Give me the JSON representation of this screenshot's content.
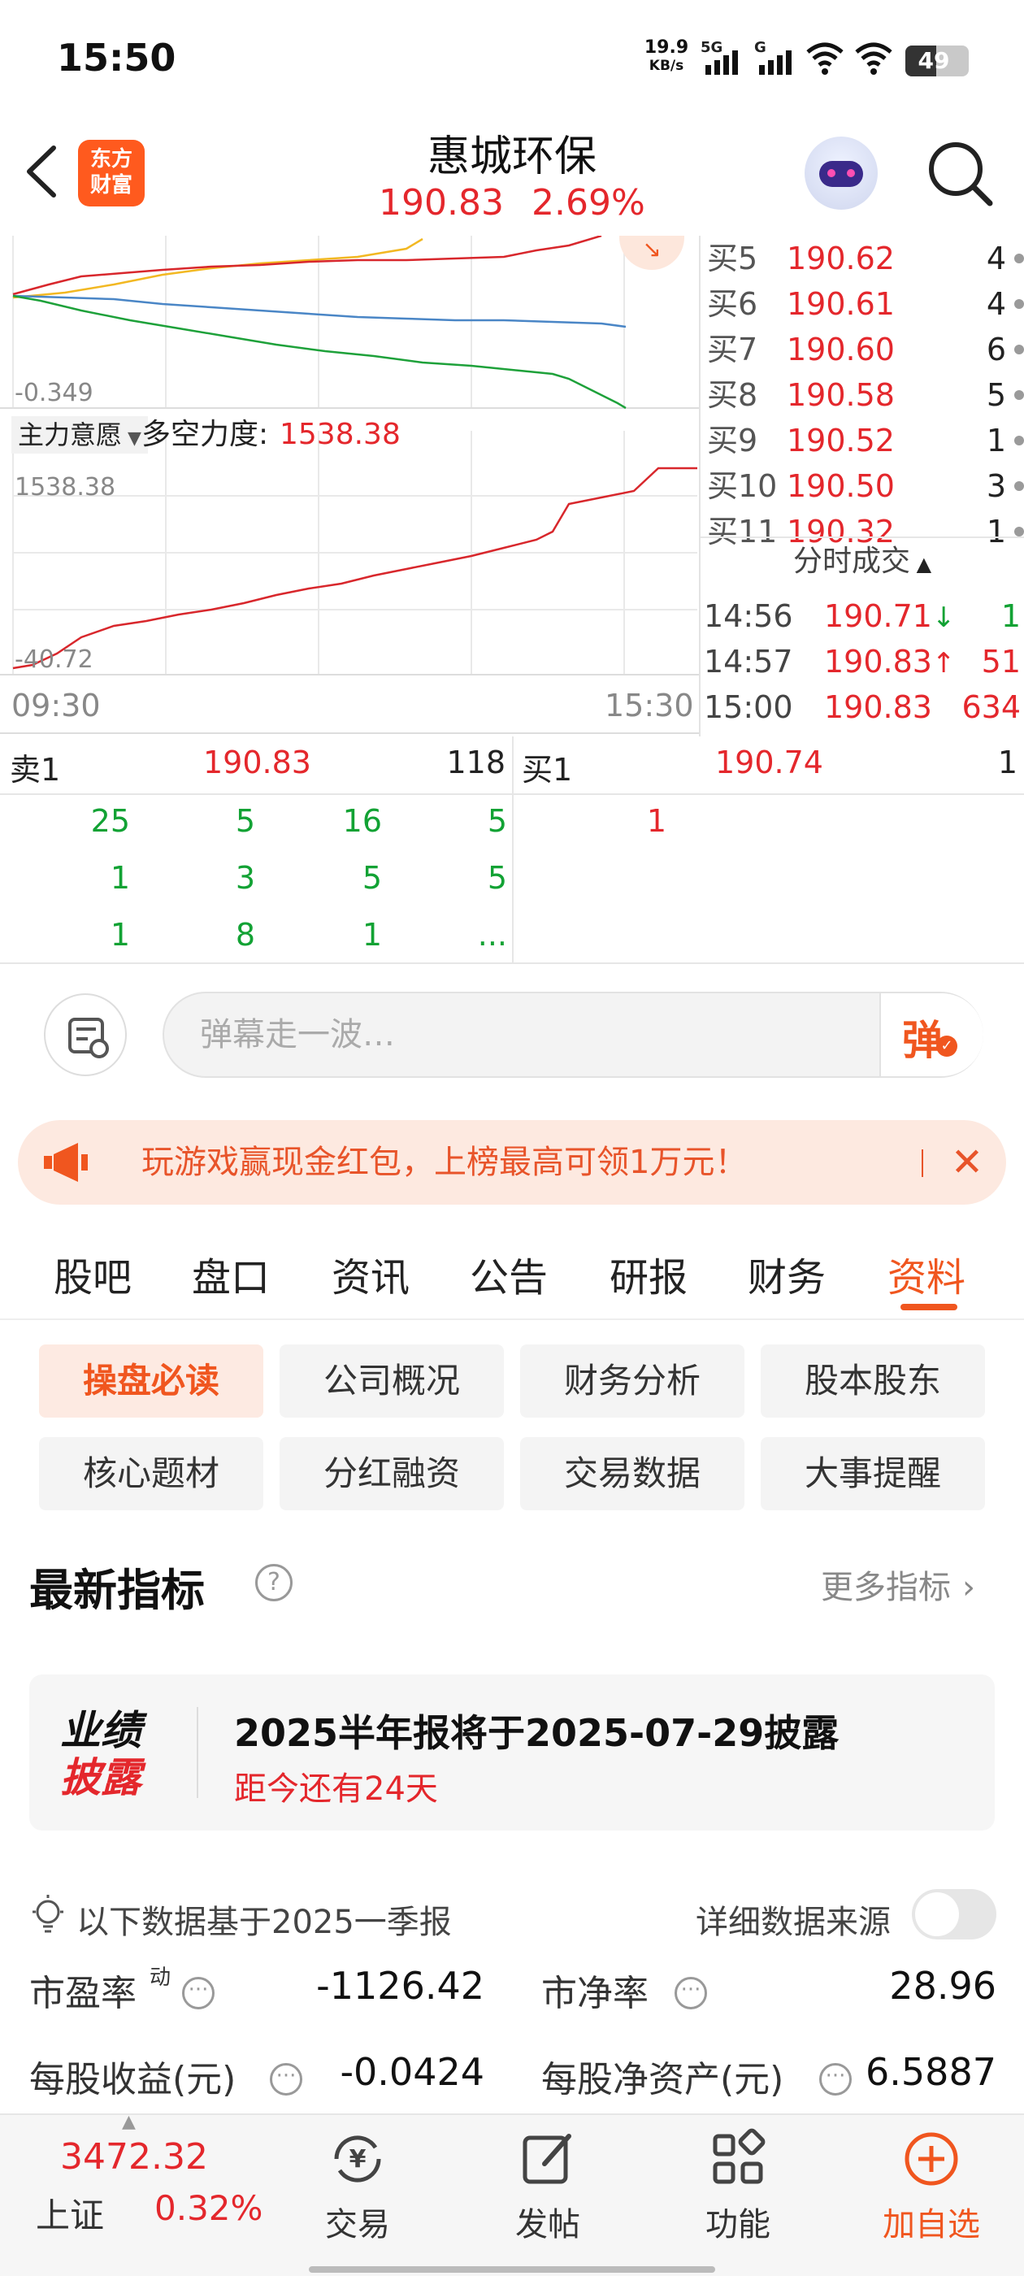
{
  "status_bar": {
    "time": "15:50",
    "net_speed": "19.9",
    "net_unit": "KB/s",
    "signal1": "5G",
    "signal2": "G",
    "battery": "49"
  },
  "header": {
    "logo_line1": "东方",
    "logo_line2": "财富",
    "stock_name": "惠城环保",
    "price": "190.83",
    "change_pct": "2.69%"
  },
  "chart1": {
    "min_label": "-0.349"
  },
  "indicator": {
    "dropdown": "主力意愿",
    "label": "多空力度:",
    "value": "1538.38",
    "max_label": "1538.38",
    "min_label": "-40.72",
    "time_start": "09:30",
    "time_end": "15:30"
  },
  "order_book": [
    {
      "label": "买5",
      "price": "190.62",
      "vol": "4"
    },
    {
      "label": "买6",
      "price": "190.61",
      "vol": "4"
    },
    {
      "label": "买7",
      "price": "190.60",
      "vol": "6"
    },
    {
      "label": "买8",
      "price": "190.58",
      "vol": "5"
    },
    {
      "label": "买9",
      "price": "190.52",
      "vol": "1"
    },
    {
      "label": "买10",
      "price": "190.50",
      "vol": "3"
    },
    {
      "label": "买11",
      "price": "190.32",
      "vol": "1"
    }
  ],
  "trades": {
    "header": "分时成交",
    "rows": [
      {
        "time": "14:56",
        "price": "190.71",
        "arrow": "↓",
        "vol": "1"
      },
      {
        "time": "14:57",
        "price": "190.83",
        "arrow": "↑",
        "vol": "51"
      },
      {
        "time": "15:00",
        "price": "190.83",
        "arrow": "",
        "vol": "634"
      }
    ]
  },
  "queue": {
    "sell_label": "卖1",
    "sell_price": "190.83",
    "sell_vol": "118",
    "buy_label": "买1",
    "buy_price": "190.74",
    "buy_vol": "1",
    "sell_rows": [
      [
        "25",
        "5",
        "16",
        "5"
      ],
      [
        "1",
        "3",
        "5",
        "5"
      ],
      [
        "1",
        "8",
        "1",
        "..."
      ]
    ],
    "buy_rows": [
      [
        "1"
      ]
    ]
  },
  "danmu": {
    "placeholder": "弹幕走一波…",
    "send_label": "弹"
  },
  "banner": {
    "text": "玩游戏赢现金红包，上榜最高可领1万元！"
  },
  "tabs": [
    "股吧",
    "盘口",
    "资讯",
    "公告",
    "研报",
    "财务",
    "资料"
  ],
  "active_tab": 6,
  "subtabs": [
    "操盘必读",
    "公司概况",
    "财务分析",
    "股本股东",
    "核心题材",
    "分红融资",
    "交易数据",
    "大事提醒"
  ],
  "active_subtab": 0,
  "section": {
    "title": "最新指标",
    "more": "更多指标"
  },
  "perf_card": {
    "badge_line1": "业绩",
    "badge_line2": "披露",
    "title": "2025半年报将于2025-07-29披露",
    "countdown": "距今还有24天"
  },
  "data_basis": {
    "text": "以下数据基于2025一季报",
    "source_label": "详细数据来源",
    "toggle_on": false
  },
  "metrics": [
    {
      "label": "市盈率",
      "sup": "动",
      "value": "-1126.42"
    },
    {
      "label": "市净率",
      "sup": "",
      "value": "28.96"
    },
    {
      "label": "每股收益(元)",
      "sup": "",
      "value": "-0.0424"
    },
    {
      "label": "每股净资产(元)",
      "sup": "",
      "value": "6.5887"
    }
  ],
  "bottom_nav": {
    "index_value": "3472.32",
    "index_name": "上证",
    "index_change": "0.32%",
    "items": [
      "交易",
      "发帖",
      "功能",
      "加自选"
    ]
  },
  "colors": {
    "up": "#e4272c",
    "down": "#12a234",
    "accent": "#f0561f"
  }
}
